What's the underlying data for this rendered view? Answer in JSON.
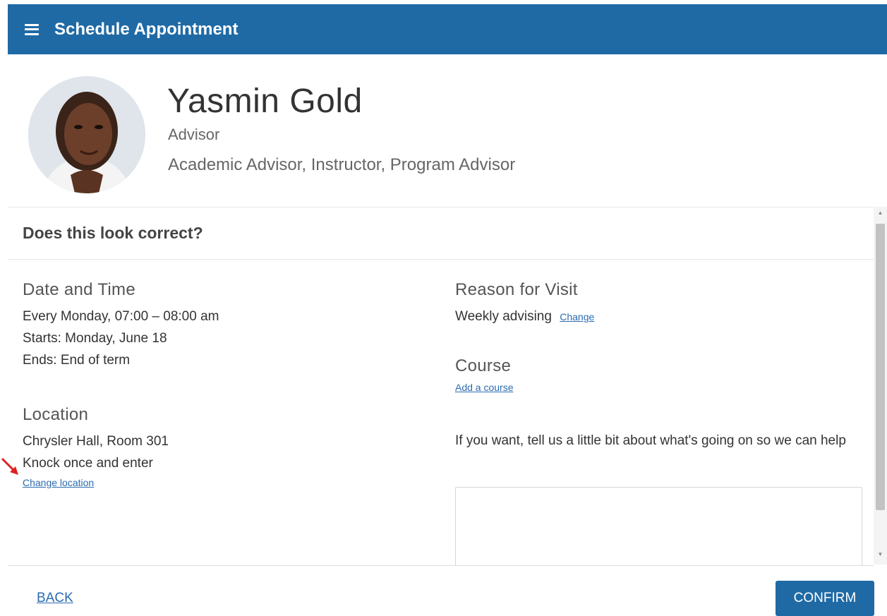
{
  "header": {
    "title": "Schedule Appointment",
    "menu_icon": "hamburger-menu-icon"
  },
  "advisor": {
    "name": "Yasmin Gold",
    "role": "Advisor",
    "specialties": "Academic Advisor, Instructor, Program Advisor"
  },
  "review": {
    "heading": "Does this look correct?",
    "date_time": {
      "title": "Date and Time",
      "recurrence": "Every Monday, 07:00 – 08:00 am",
      "starts": "Starts: Monday, June 18",
      "ends": "Ends: End of term"
    },
    "location": {
      "title": "Location",
      "place": "Chrysler Hall, Room 301",
      "instructions": "Knock once and enter",
      "change_label": "Change location"
    },
    "reason": {
      "title": "Reason for Visit",
      "value": "Weekly advising",
      "change_label": "Change"
    },
    "course": {
      "title": "Course",
      "add_label": "Add a course"
    },
    "notes": {
      "prompt": "If you want, tell us a little bit about what's going on so we can help",
      "value": ""
    }
  },
  "footer": {
    "back_label": "BACK",
    "confirm_label": "CONFIRM"
  },
  "colors": {
    "primary": "#1f6aa5",
    "link": "#2b6cb0",
    "annotation_arrow": "#e02020"
  }
}
